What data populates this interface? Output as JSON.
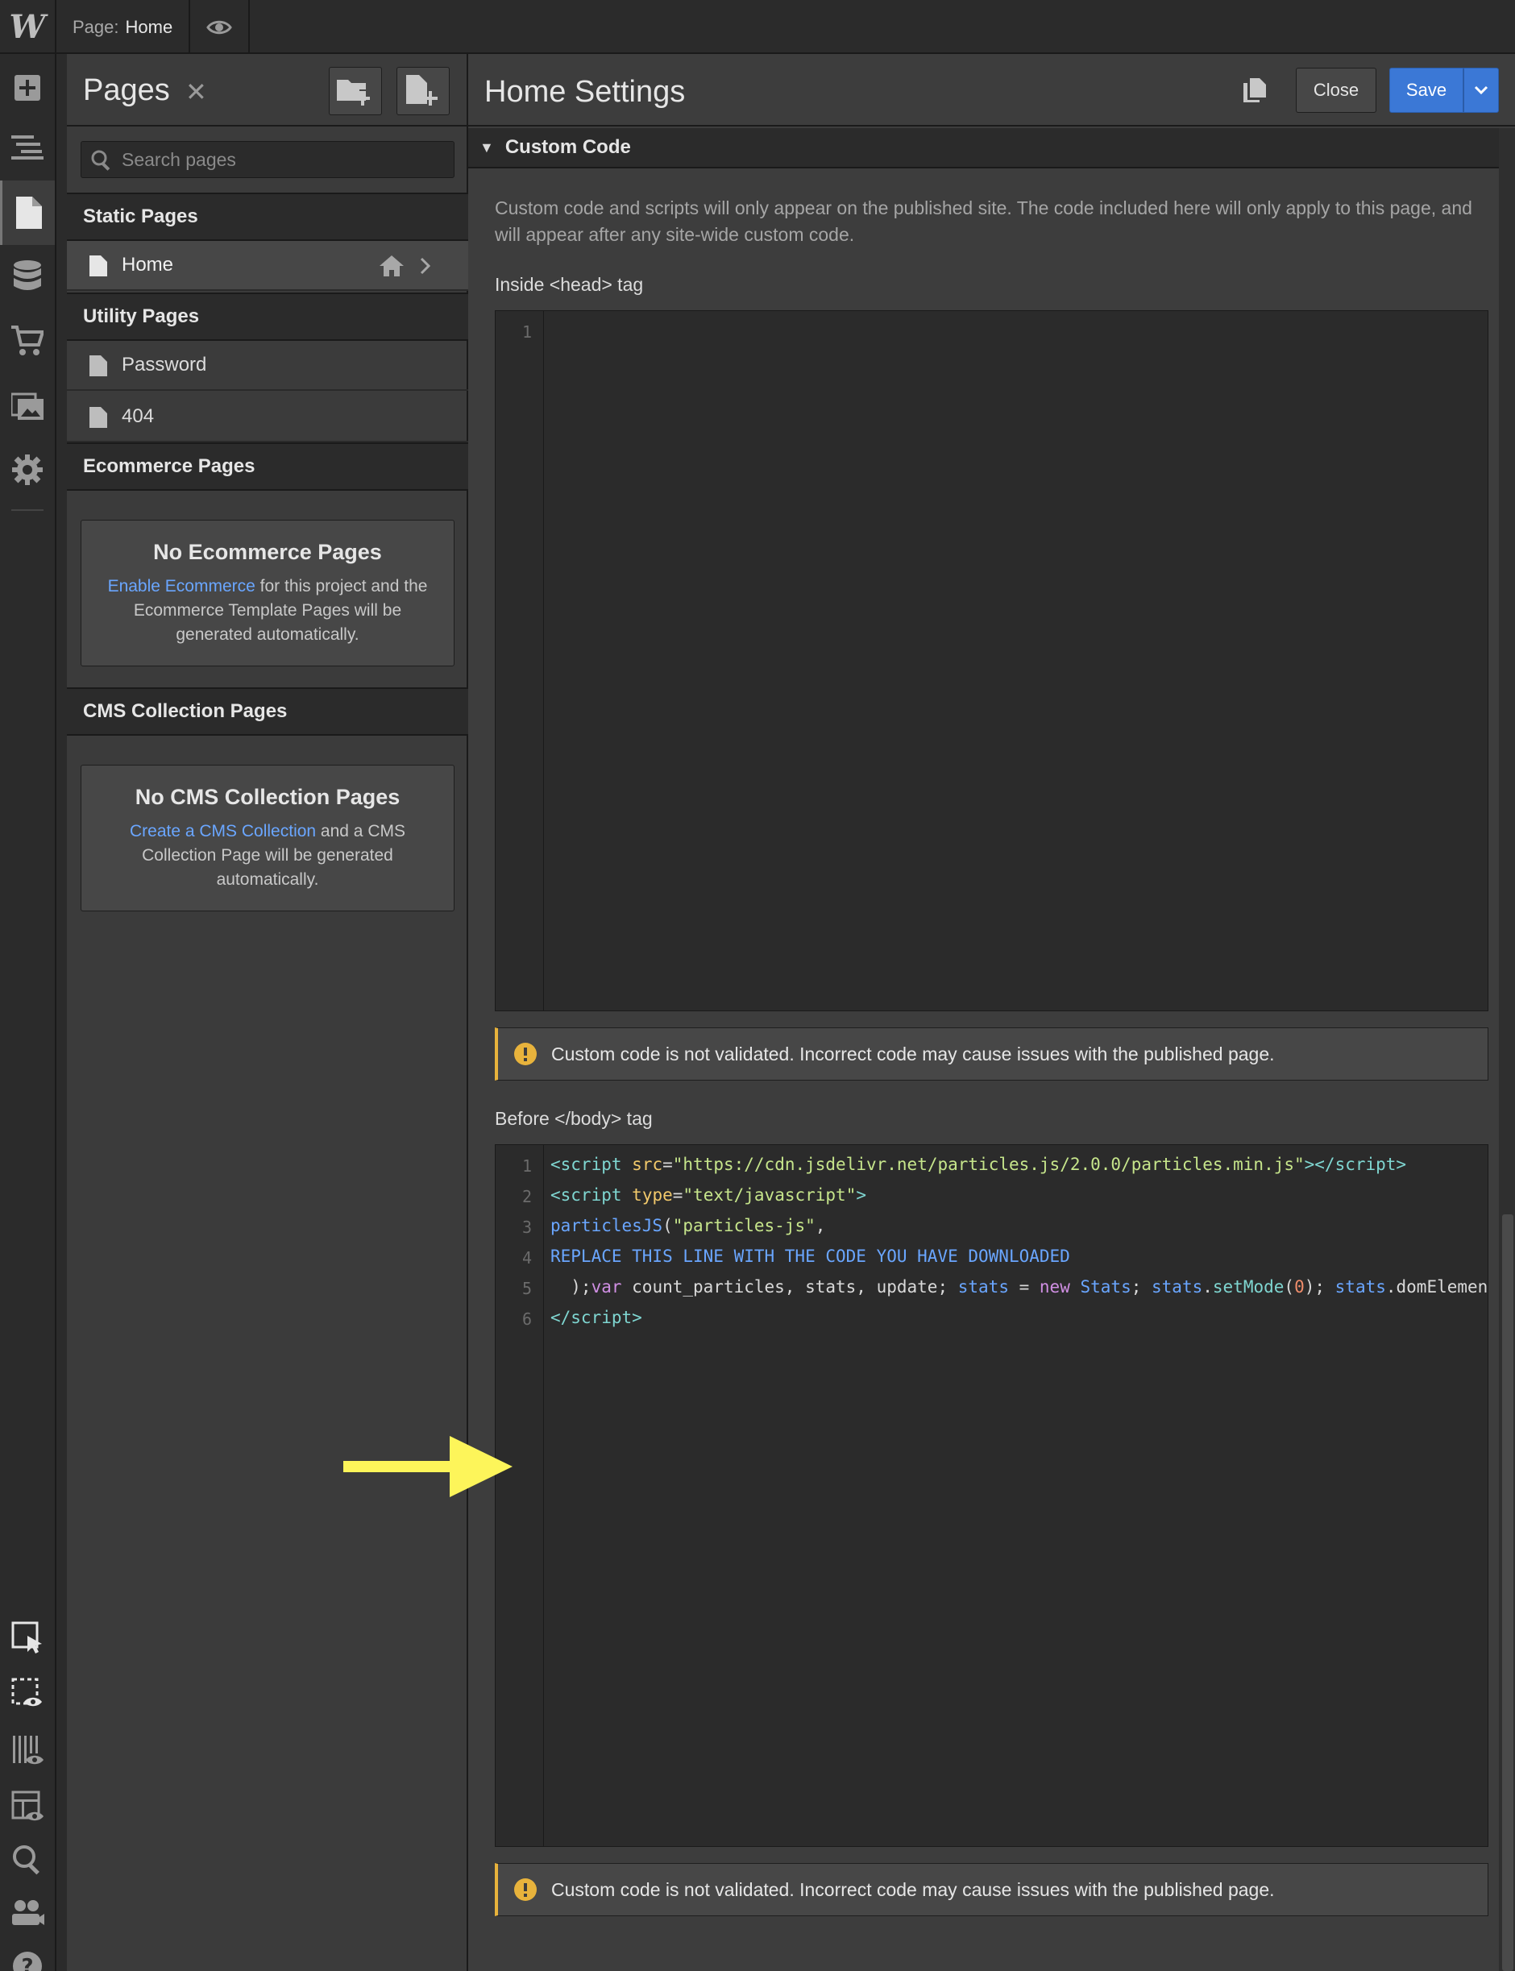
{
  "topbar": {
    "logo": "W",
    "page_label": "Page:",
    "page_value": "Home",
    "preview_icon": "eye-icon"
  },
  "rail": {
    "items": [
      {
        "name": "add-icon"
      },
      {
        "name": "navigator-icon"
      },
      {
        "name": "pages-icon",
        "active": true
      },
      {
        "name": "cms-icon"
      },
      {
        "name": "ecommerce-icon"
      },
      {
        "name": "assets-icon"
      },
      {
        "name": "settings-icon"
      }
    ],
    "bottom_items": [
      {
        "name": "select-element-icon"
      },
      {
        "name": "preview-element-icon"
      },
      {
        "name": "audit-icon"
      },
      {
        "name": "layout-preview-icon"
      },
      {
        "name": "search-icon"
      },
      {
        "name": "users-icon"
      },
      {
        "name": "help-icon"
      }
    ]
  },
  "pages_panel": {
    "title": "Pages",
    "search_placeholder": "Search pages",
    "static_header": "Static Pages",
    "static_pages": [
      {
        "label": "Home"
      }
    ],
    "utility_header": "Utility Pages",
    "utility_pages": [
      {
        "label": "Password"
      },
      {
        "label": "404"
      }
    ],
    "ecommerce_header": "Ecommerce Pages",
    "ecommerce_empty": {
      "title": "No Ecommerce Pages",
      "link": "Enable Ecommerce",
      "text": " for this project and the Ecommerce Template Pages will be generated automatically."
    },
    "cms_header": "CMS Collection Pages",
    "cms_empty": {
      "title": "No CMS Collection Pages",
      "link": "Create a CMS Collection",
      "text": " and a CMS Collection Page will be generated automatically."
    }
  },
  "settings_panel": {
    "title": "Home Settings",
    "close_label": "Close",
    "save_label": "Save",
    "section_title": "Custom Code",
    "description": "Custom code and scripts will only appear on the published site. The code included here will only apply to this page, and will appear after any site-wide custom code.",
    "head_label": "Inside <head> tag",
    "body_label": "Before </body> tag",
    "warning": "Custom code is not validated. Incorrect code may cause issues with the published page.",
    "head_lines": [
      "1"
    ],
    "body_lines": [
      "1",
      "2",
      "3",
      "4",
      "5",
      "6"
    ]
  },
  "colors": {
    "accent": "#3b78d6",
    "link": "#6aa6ff",
    "warning": "#e8b33c",
    "arrow": "#fdf55a"
  }
}
